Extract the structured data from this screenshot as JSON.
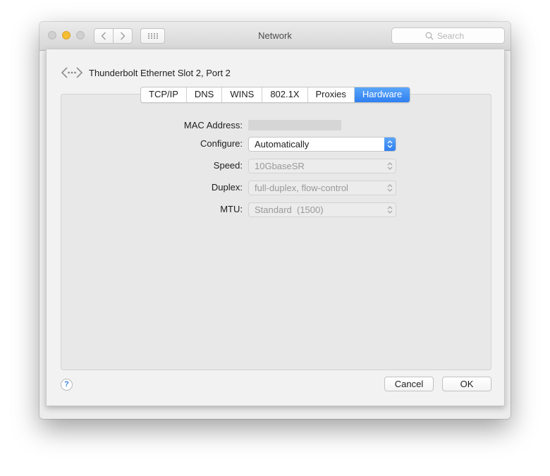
{
  "window": {
    "title": "Network"
  },
  "titlebar": {
    "search_placeholder": "Search"
  },
  "device": {
    "name": "Thunderbolt Ethernet Slot 2, Port 2"
  },
  "tabs": [
    {
      "label": "TCP/IP",
      "selected": false
    },
    {
      "label": "DNS",
      "selected": false
    },
    {
      "label": "WINS",
      "selected": false
    },
    {
      "label": "802.1X",
      "selected": false
    },
    {
      "label": "Proxies",
      "selected": false
    },
    {
      "label": "Hardware",
      "selected": true
    }
  ],
  "hardware": {
    "mac_label": "MAC Address:",
    "configure_label": "Configure:",
    "configure_value": "Automatically",
    "speed_label": "Speed:",
    "speed_value": "10GbaseSR",
    "duplex_label": "Duplex:",
    "duplex_value": "full-duplex, flow-control",
    "mtu_label": "MTU:",
    "mtu_value": "Standard  (1500)"
  },
  "footer": {
    "help_symbol": "?",
    "cancel_label": "Cancel",
    "ok_label": "OK"
  },
  "colors": {
    "accent": "#3a8cf6",
    "minimize": "#f5bd32"
  }
}
